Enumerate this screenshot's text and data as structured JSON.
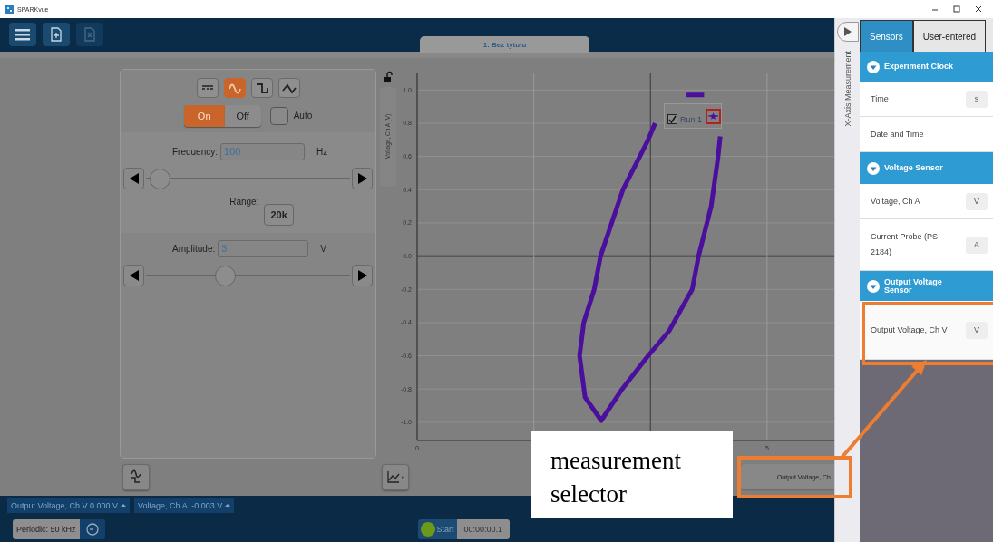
{
  "title_bar": {
    "title": "SPARKvue"
  },
  "toolbar": {
    "buttons": [
      {
        "kind": "menu",
        "disabled": false
      },
      {
        "kind": "add",
        "disabled": false
      },
      {
        "kind": "remove",
        "disabled": true
      }
    ]
  },
  "page_tab": {
    "label": "1: Bez tytułu",
    "selected": true
  },
  "signal_generator": {
    "waveforms": [
      {
        "kind": "dc",
        "selected": false
      },
      {
        "kind": "sine",
        "selected": true
      },
      {
        "kind": "square",
        "selected": false
      },
      {
        "kind": "triangle",
        "selected": false
      }
    ],
    "power": {
      "on_label": "On",
      "off_label": "Off",
      "on": true
    },
    "auto": {
      "label": "Auto",
      "checked": false
    },
    "frequency": {
      "label": "Frequency:",
      "value": "100",
      "unit": "Hz",
      "level": 0.03
    },
    "range": {
      "label": "Range:",
      "value": "20k"
    },
    "amplitude": {
      "label": "Amplitude:",
      "value": "3",
      "unit": "V",
      "level": 0.38
    }
  },
  "graph": {
    "locked": false,
    "legend": {
      "checked": true
    },
    "x_selector": "Output Voltage, Ch",
    "chart_data": {
      "type": "line",
      "ylabel": "Voltage, Ch A (V)",
      "xlim": [
        0,
        5.96
      ],
      "ylim": [
        -1.11,
        1.1
      ],
      "grid": true,
      "xticks": [
        0,
        5
      ],
      "ref_lines": [
        {
          "axis": "x",
          "value": 1.667,
          "color": "#999999"
        },
        {
          "axis": "x",
          "value": 3.333,
          "color": "#3a3a3a"
        },
        {
          "axis": "x",
          "value": 5,
          "color": "#999999"
        }
      ],
      "yticks": [
        {
          "value": 1,
          "label": "1.0"
        },
        {
          "value": 0.8,
          "label": "0.8"
        },
        {
          "value": 0.6,
          "label": "0.6"
        },
        {
          "value": 0.4,
          "label": "0.4"
        },
        {
          "value": 0.2,
          "label": "0.2"
        },
        {
          "value": 0,
          "label": "0.0"
        },
        {
          "value": -0.2,
          "label": "-0.2"
        },
        {
          "value": -0.4,
          "label": "-0.4"
        },
        {
          "value": -0.6,
          "label": "-0.6"
        },
        {
          "value": -0.8,
          "label": "-0.8"
        },
        {
          "value": -1,
          "label": "-1.0"
        }
      ],
      "x": [
        3.85,
        4.1,
        4.25,
        4.33,
        4.3,
        4.2,
        4.02,
        3.93,
        3.6,
        3.3,
        2.93,
        2.63,
        2.4,
        2.32,
        2.38,
        2.53,
        2.62,
        2.94,
        3.3,
        3.4
      ],
      "series": [
        {
          "name": "Run 1",
          "color": "#4b0f9e",
          "values": [
            0.97,
            0.97,
            null,
            0.72,
            0.6,
            0.3,
            0.0,
            -0.2,
            -0.45,
            -0.6,
            -0.8,
            -0.99,
            -0.85,
            -0.6,
            -0.4,
            -0.2,
            0.0,
            0.4,
            0.7,
            0.8
          ]
        }
      ]
    }
  },
  "live_readouts": [
    {
      "label": "Output Voltage, Ch V 0.000 V"
    },
    {
      "label": "Voltage, Ch A  -0.003 V"
    }
  ],
  "bottom_bar": {
    "sampling": "Periodic: 50 kHz",
    "start": "Start",
    "timer": "00:00:00.1"
  },
  "x_axis_panel": {
    "title": "X-Axis Measurement"
  },
  "sensor_panel": {
    "tabs": [
      {
        "label": "Sensors",
        "selected": true
      },
      {
        "label": "User-entered",
        "selected": false
      }
    ],
    "groups": [
      {
        "title": "Experiment Clock",
        "expanded": true,
        "items": [
          {
            "name": "Time",
            "unit": "s",
            "highlighted": false
          },
          {
            "name": "Date and Time",
            "highlighted": false
          }
        ]
      },
      {
        "title": "Voltage Sensor",
        "expanded": true,
        "items": [
          {
            "name": "Voltage, Ch A",
            "unit": "V",
            "highlighted": false
          },
          {
            "name": "Current Probe (PS-2184)",
            "unit": "A",
            "highlighted": false
          }
        ]
      },
      {
        "title": "Output Voltage Sensor",
        "expanded": true,
        "items": [
          {
            "name": "Output Voltage, Ch V",
            "unit": "V",
            "highlighted": true
          }
        ]
      }
    ]
  },
  "annotation": {
    "text": "measurement selector"
  }
}
